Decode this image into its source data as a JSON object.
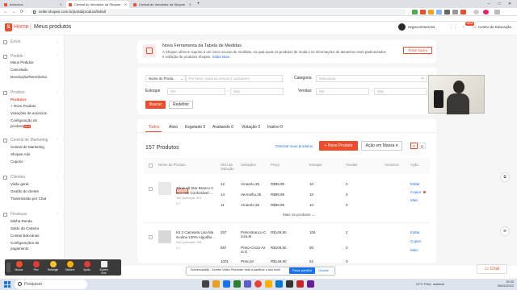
{
  "browser": {
    "tabs": [
      "Anúncios",
      "Central do Vendedor da Shopee",
      "Central do Vendedor da Shopee"
    ],
    "url": "seller.shopee.com.br/portal/product/list/all",
    "controls": {
      "min": "–",
      "max": "□",
      "close": "✕"
    },
    "nav": {
      "back": "←",
      "forward": "→",
      "reload": "⟳"
    }
  },
  "header": {
    "logo": "S",
    "home": "Home",
    "sep": "|",
    "title": "Meus produtos",
    "account": "negocommerce2",
    "badge": "NEW",
    "edu": "Centro de Educação"
  },
  "sidebar": {
    "envio": {
      "header": "Envio"
    },
    "pedido": {
      "header": "Pedido",
      "items": [
        "Meus Pedidos",
        "Cancelado",
        "Devolução/Reembolso"
      ]
    },
    "produto": {
      "header": "Produto",
      "items": [
        "Produtos",
        "+ Novo Produto",
        "Violações de anúncios",
        "Configuração do",
        "produto"
      ],
      "new": "Novo"
    },
    "marketing": {
      "header": "Central de Marketing",
      "items": [
        "Central de Marketing",
        "Shopee Ads",
        "Cupons"
      ]
    },
    "clientes": {
      "header": "Clientes",
      "items": [
        "Visão geral",
        "Gestão do cliente",
        "Transmissão por Chat"
      ]
    },
    "financas": {
      "header": "Finanças",
      "items": [
        "Minha Renda",
        "Saldo da Carteira",
        "Contas Bancárias",
        "Configurações de",
        "pagamento"
      ]
    }
  },
  "banner": {
    "title": "Nova Ferramenta da Tabela de Medidas",
    "body": "A Shopee oferece suporte a um novo recurso de medidas, na qual quais os produtos de moda e se informações de tamanhos mais padronizados e exibição de produtos Shopee. Saiba Mais",
    "link": "Saiba Mais",
    "button": "Tente Agora"
  },
  "filters": {
    "name_select": "Nome do Produ...",
    "name_placeholder": "Por favor, insira ao menos 2 caracteres",
    "category_label": "Categoria",
    "category_placeholder": "Selecionar",
    "stock_label": "Estoque",
    "min": "Min",
    "max": "Máx",
    "sales_label": "Vendas",
    "sep": "-",
    "search": "Buscar",
    "reset": "Redefinir"
  },
  "status_tabs": [
    "Todos",
    "Ativo",
    "Esgotado 0",
    "Avaliando 0",
    "Violação 0",
    "Inativo 0"
  ],
  "list": {
    "count": "157 Produtos",
    "optimize": "Otimizar seus produtos",
    "new_product": "+ Novo Produto",
    "bulk": "Ação em Massa",
    "bulk_caret": "▾",
    "view_list": "☰",
    "view_grid": "▦"
  },
  "table": {
    "headers": [
      "Nome do Produto",
      "SKU da Variação",
      "Variações",
      "Preço",
      "Estoque",
      "Vendas",
      "Anúncios",
      "Ação"
    ],
    "products": [
      {
        "tag": "Subtes",
        "name1": "Tênis All Star Branco C",
        "name2": "ano Alto Confortável ...",
        "sku_line": "SKU principal: 001",
        "stats": "0   1",
        "rows": [
          [
            "12",
            "Amarelo,35",
            "R$99,99",
            "10",
            "0"
          ],
          [
            "14",
            "Vermelho,35",
            "R$99,99",
            "10",
            "0"
          ],
          [
            "11",
            "Amarelo,36",
            "R$99,99",
            "10",
            "0"
          ]
        ],
        "more": "Mais 15 produtos",
        "actions": [
          "Editar",
          "Copiar",
          "Mais"
        ]
      },
      {
        "name1": "Kit 3 Camiseta Lisa Ma",
        "name2": "sculina 100% Algodão...",
        "sku_line": "SKU principal: 238",
        "stats": "0   1",
        "rows": [
          [
            "257",
            "Preto-Branco-C inza,M",
            "R$149,90",
            "106",
            "2"
          ],
          [
            "987",
            "Preto-Cinza-Az ul,G",
            "R$109,90",
            "90",
            "0"
          ],
          [
            "1001",
            "Preto,M",
            "R$149,90",
            "52",
            "0"
          ]
        ],
        "actions": [
          "Editar",
          "Copiar",
          "Mais"
        ]
      }
    ]
  },
  "recorder": {
    "buttons": [
      "Mouse",
      "Pen",
      "Retangle",
      "Stickers",
      "Spots",
      "Screen Size"
    ]
  },
  "notification": {
    "text": "Screencastify - Screen Video Recorder está a partilhar o seu ecrã.",
    "stop": "Parar partilha",
    "hide": "Ocultar"
  },
  "chat": "Chat",
  "taskbar": {
    "search": "Pesquisar",
    "weather": "21°C  Pred. nublado",
    "time": "15:33",
    "date": "08/02/2022"
  },
  "float_icons": [
    "⧉",
    "⊕"
  ]
}
